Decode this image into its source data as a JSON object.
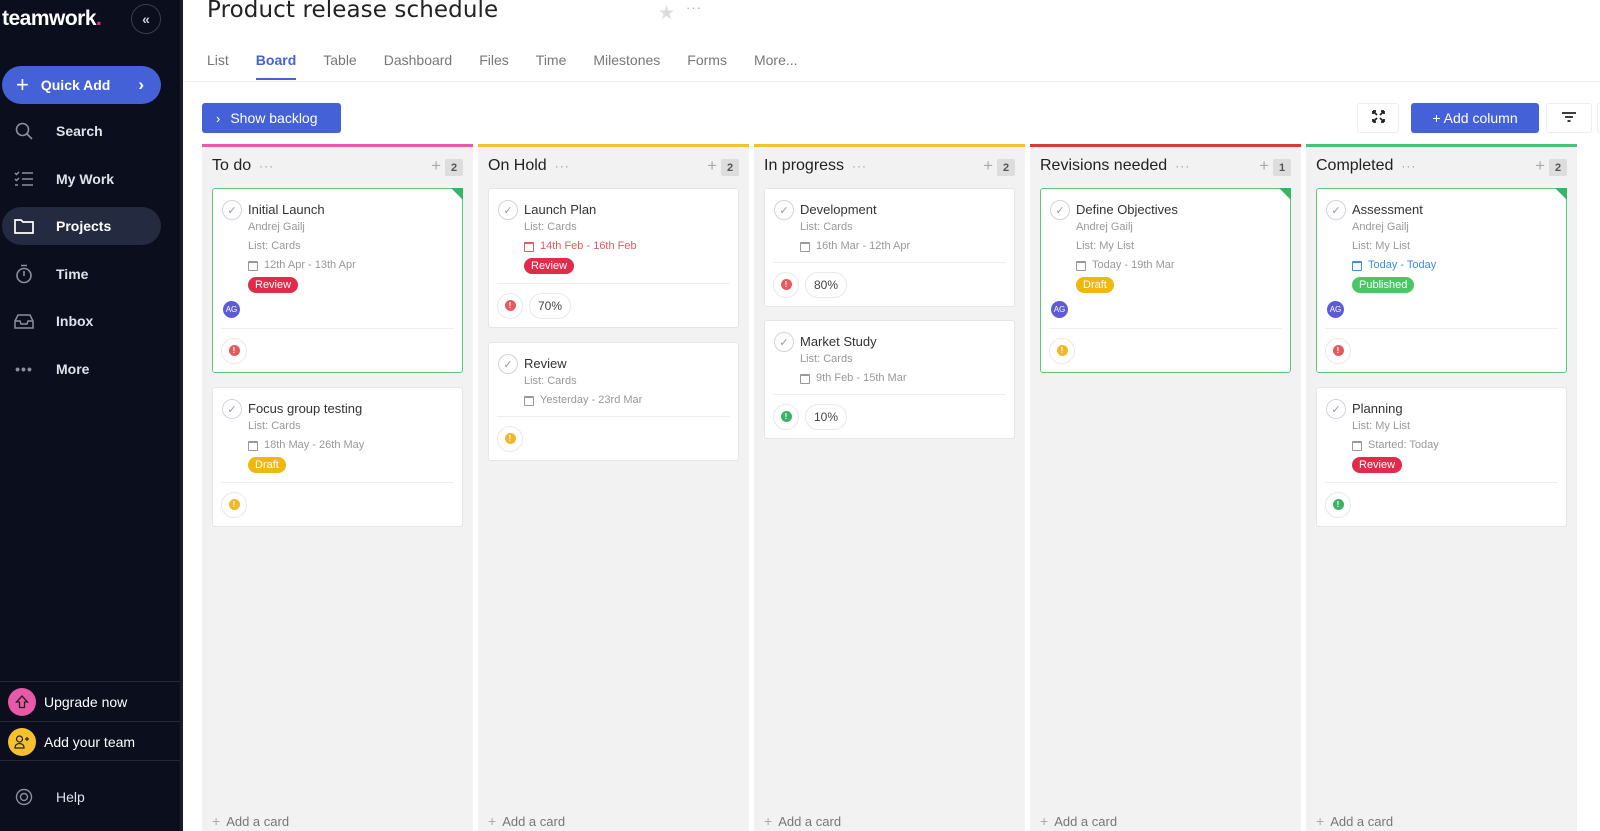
{
  "sidebar": {
    "logo": "teamwork",
    "logo_dot": ".",
    "collapse_icon": "«",
    "quick_add": "Quick Add",
    "nav": [
      {
        "label": "Search",
        "icon": "search-icon"
      },
      {
        "label": "My Work",
        "icon": "checklist-icon"
      },
      {
        "label": "Projects",
        "icon": "folder-icon",
        "active": true
      },
      {
        "label": "Time",
        "icon": "stopwatch-icon"
      },
      {
        "label": "Inbox",
        "icon": "inbox-icon"
      },
      {
        "label": "More",
        "icon": "more-icon"
      }
    ],
    "upgrade": "Upgrade now",
    "add_team": "Add your team",
    "help": "Help"
  },
  "header": {
    "title": "Product release schedule",
    "more": "···"
  },
  "tabs": [
    "List",
    "Board",
    "Table",
    "Dashboard",
    "Files",
    "Time",
    "Milestones",
    "Forms",
    "More..."
  ],
  "active_tab": "Board",
  "toolbar": {
    "show_backlog": "Show backlog",
    "add_column": "+ Add column"
  },
  "colors": {
    "accent": "#4461d7",
    "sidebar_bg": "#0b0e1c",
    "todo": "#e85aa8",
    "on_hold": "#f5c12e",
    "in_progress": "#f5c12e",
    "revisions": "#d93b2f",
    "completed": "#49c07a"
  },
  "board": {
    "add_card_label": "Add a card",
    "columns": [
      {
        "title": "To do",
        "count": "2",
        "cards": [
          {
            "title": "Initial Launch",
            "assignee": "Andrej Gailj",
            "list": "List: Cards",
            "date": "12th Apr - 13th Apr",
            "tag": "Review",
            "avatar": "AG",
            "priority": "high",
            "highlighted": true
          },
          {
            "title": "Focus group testing",
            "list": "List: Cards",
            "date": "18th May - 26th May",
            "tag": "Draft",
            "priority": "medium"
          }
        ]
      },
      {
        "title": "On Hold",
        "count": "2",
        "cards": [
          {
            "title": "Launch Plan",
            "list": "List: Cards",
            "date": "14th Feb - 16th Feb",
            "date_status": "overdue",
            "tag": "Review",
            "priority": "high",
            "progress": "70%"
          },
          {
            "title": "Review",
            "list": "List: Cards",
            "date": "Yesterday - 23rd Mar",
            "priority": "medium"
          }
        ]
      },
      {
        "title": "In progress",
        "count": "2",
        "cards": [
          {
            "title": "Development",
            "list": "List: Cards",
            "date": "16th Mar - 12th Apr",
            "priority": "high",
            "progress": "80%"
          },
          {
            "title": "Market Study",
            "list": "List: Cards",
            "date": "9th Feb - 15th Mar",
            "priority": "low",
            "progress": "10%"
          }
        ]
      },
      {
        "title": "Revisions needed",
        "count": "1",
        "cards": [
          {
            "title": "Define Objectives",
            "assignee": "Andrej Gailj",
            "list": "List: My List",
            "date": "Today - 19th Mar",
            "tag": "Draft",
            "avatar": "AG",
            "priority": "medium",
            "highlighted": true
          }
        ]
      },
      {
        "title": "Completed",
        "count": "2",
        "cards": [
          {
            "title": "Assessment",
            "assignee": "Andrej Gailj",
            "list": "List: My List",
            "date": "Today - Today",
            "date_status": "today",
            "tag": "Published",
            "avatar": "AG",
            "priority": "high",
            "highlighted": true
          },
          {
            "title": "Planning",
            "list": "List: My List",
            "date": "Started: Today",
            "tag": "Review",
            "priority": "low"
          }
        ]
      }
    ]
  }
}
